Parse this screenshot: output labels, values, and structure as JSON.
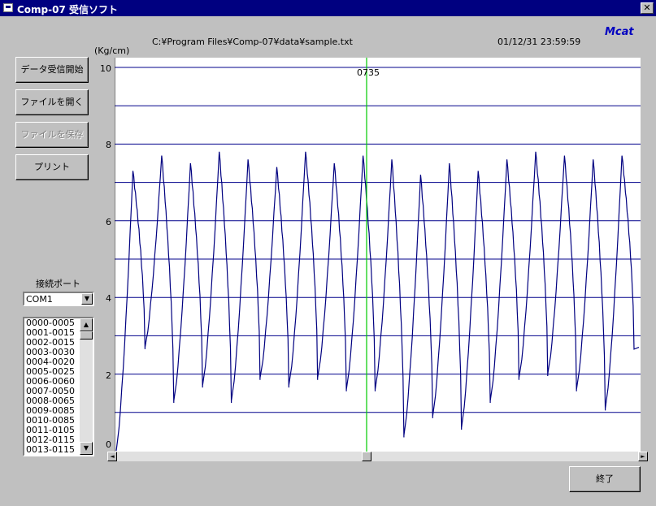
{
  "window": {
    "title": "Comp-07 受信ソフト",
    "close_label": "✕"
  },
  "header": {
    "filepath": "C:¥Program Files¥Comp-07¥data¥sample.txt",
    "datetime": "01/12/31 23:59:59",
    "brand": "Mcat",
    "unit": "(Kg/cm)"
  },
  "buttons": {
    "receive": "データ受信開始",
    "open": "ファイルを開く",
    "save": "ファイルを保存",
    "print": "プリント",
    "exit": "終了"
  },
  "port": {
    "label": "接続ポート",
    "selected": "COM1"
  },
  "port_list": [
    "0000-0005",
    "0001-0015",
    "0002-0015",
    "0003-0030",
    "0004-0020",
    "0005-0025",
    "0006-0060",
    "0007-0050",
    "0008-0065",
    "0009-0085",
    "0010-0085",
    "0011-0105",
    "0012-0115",
    "0013-0115"
  ],
  "chart_data": {
    "type": "line",
    "ylabel": "(Kg/cm)",
    "ylim": [
      0,
      10
    ],
    "yticks": [
      0,
      2,
      4,
      6,
      8,
      10
    ],
    "gridlines_y": [
      1,
      2,
      3,
      4,
      5,
      6,
      7,
      8,
      9,
      10
    ],
    "grid": true,
    "cursor_label": "0735",
    "line_color": "#000080",
    "grid_color": "#00008b",
    "cursor_color": "#00cc00",
    "series": [
      {
        "peaks": [
          7.3,
          7.7,
          7.5,
          7.8,
          7.6,
          7.4,
          7.8,
          7.5,
          7.7,
          7.6,
          7.2,
          7.5,
          7.3,
          7.6,
          7.8,
          7.7,
          7.6,
          7.7
        ],
        "troughs": [
          0.0,
          2.7,
          1.3,
          1.7,
          1.3,
          1.9,
          1.7,
          1.9,
          1.6,
          1.6,
          0.4,
          0.9,
          0.6,
          1.3,
          1.9,
          2.0,
          1.6,
          1.1,
          2.7
        ]
      }
    ]
  },
  "colors": {
    "window_bg": "#c0c0c0",
    "titlebar": "#000080",
    "brand": "#0000c0"
  }
}
